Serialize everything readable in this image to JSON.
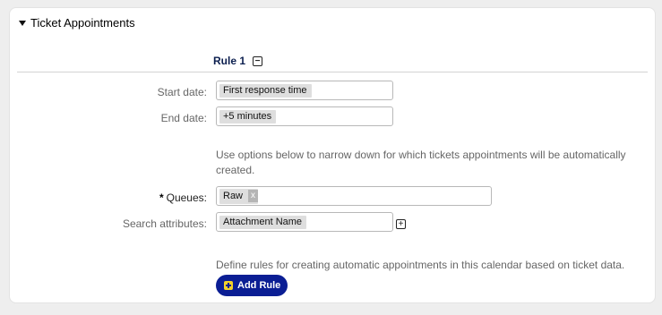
{
  "section": {
    "title": "Ticket Appointments",
    "toggle_icon": "caret-down-icon"
  },
  "rule": {
    "title": "Rule 1",
    "remove_icon": "minus-square-icon",
    "start_date": {
      "label": "Start date:",
      "value": "First response time"
    },
    "end_date": {
      "label": "End date:",
      "value": "+5 minutes"
    },
    "options_help": "Use options below to narrow down for which tickets appointments will be automatically created.",
    "options_help_line1": "Use options below to narrow down for which tickets appointments will be automatically",
    "options_help_line2": "created.",
    "queues": {
      "required_marker": "*",
      "label": "Queues:",
      "selected": [
        "Raw"
      ],
      "remove_token_label": "x"
    },
    "search_attributes": {
      "label": "Search attributes:",
      "value": "Attachment Name",
      "add_icon": "plus-square-icon"
    }
  },
  "footer": {
    "help": "Define rules for creating automatic appointments in this calendar based on ticket data.",
    "add_rule_label": "Add Rule",
    "add_rule_icon": "plus-square-icon"
  },
  "colors": {
    "primary_button": "#0b1e94",
    "button_icon": "#f4d22a",
    "card_background": "#ffffff",
    "page_background": "#eeeeee"
  }
}
